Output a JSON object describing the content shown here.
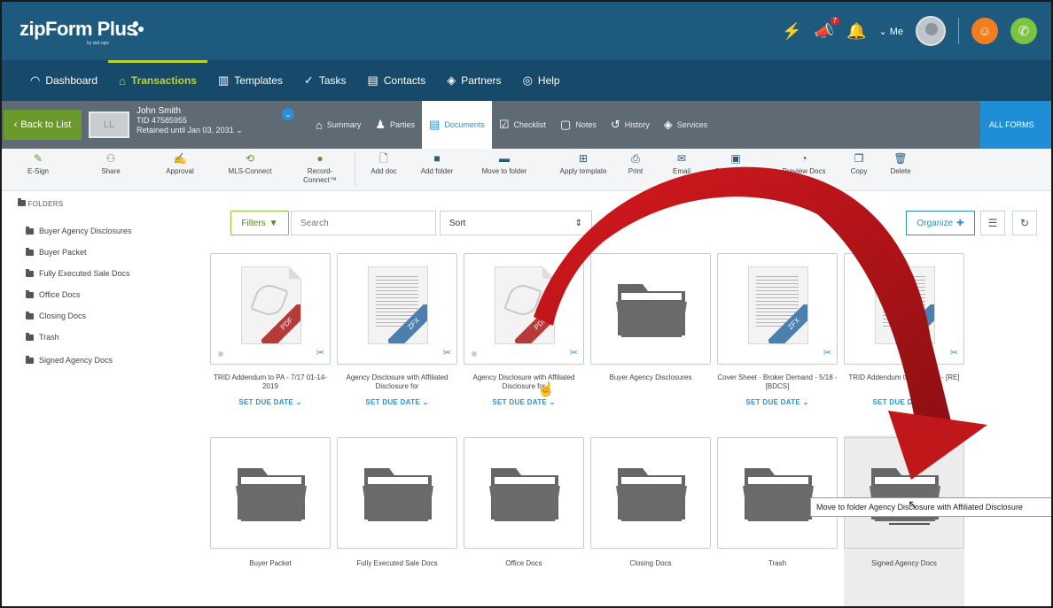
{
  "header": {
    "logo": "zipForm Plus",
    "logo_sub": "by zipLogix",
    "notification_badge": "7",
    "me_label": "Me"
  },
  "nav": [
    {
      "label": "Dashboard",
      "icon": "dashboard-icon"
    },
    {
      "label": "Transactions",
      "icon": "home-icon"
    },
    {
      "label": "Templates",
      "icon": "templates-icon"
    },
    {
      "label": "Tasks",
      "icon": "tasks-icon"
    },
    {
      "label": "Contacts",
      "icon": "contacts-icon"
    },
    {
      "label": "Partners",
      "icon": "partners-icon"
    },
    {
      "label": "Help",
      "icon": "help-icon"
    }
  ],
  "transaction": {
    "back_label": "Back to List",
    "thumb_label": "LL",
    "name": "John Smith",
    "tid": "TID 47585955",
    "retained": "Retained until Jan 03, 2031",
    "tabs": [
      "Summary",
      "Parties",
      "Documents",
      "Checklist",
      "Notes",
      "History",
      "Services"
    ],
    "all_forms": "ALL FORMS"
  },
  "toolbar": [
    {
      "label": "E-Sign"
    },
    {
      "label": "Share"
    },
    {
      "label": "Approval"
    },
    {
      "label": "MLS-Connect"
    },
    {
      "label": "Record-Connect™"
    },
    {
      "label": "Add doc"
    },
    {
      "label": "Add folder"
    },
    {
      "label": "Move to folder"
    },
    {
      "label": "Apply template"
    },
    {
      "label": "Print"
    },
    {
      "label": "Email"
    },
    {
      "label": "Save as PDF"
    },
    {
      "label": "Preview Docs"
    },
    {
      "label": "Copy"
    },
    {
      "label": "Delete"
    }
  ],
  "sidebar": {
    "title": "FOLDERS",
    "folders": [
      "Buyer Agency Disclosures",
      "Buyer Packet",
      "Fully Executed Sale Docs",
      "Office Docs",
      "Closing Docs",
      "Trash",
      "Signed Agency Docs"
    ]
  },
  "controls": {
    "filters": "Filters",
    "search_placeholder": "Search",
    "sort": "Sort",
    "organize": "Organize"
  },
  "row1": [
    {
      "type": "pdf",
      "label": "TRID Addendum to PA - 7/17 01-14-2019",
      "band": "PDF",
      "due": "SET DUE DATE"
    },
    {
      "type": "zfx",
      "label": "Agency Disclosure with Affiliated Disclosure for",
      "band": "ZFX",
      "due": "SET DUE DATE"
    },
    {
      "type": "pdf",
      "label": "Agency Disclosure with Affiliated Disclosure for",
      "band": "PDF",
      "due": "SET DUE DATE"
    },
    {
      "type": "folder",
      "label": "Buyer Agency Disclosures"
    },
    {
      "type": "zfx",
      "label": "Cover Sheet - Broker Demand - 5/18 - [BDCS]",
      "band": "ZFX",
      "due": "SET DUE DATE"
    },
    {
      "type": "zfx",
      "label": "TRID Addendum to PA - 7/17 - [RE]",
      "band": "ZFX",
      "due": "SET DUE DATE"
    }
  ],
  "row2": [
    "Buyer Packet",
    "Fully Executed Sale Docs",
    "Office Docs",
    "Closing Docs",
    "Trash",
    "Signed Agency Docs"
  ],
  "tooltip": "Move to folder Agency Disclosure with Affiliated Disclosure",
  "colors": {
    "header": "#1d5a7e",
    "nav": "#17496a",
    "accent_green": "#b8d430",
    "arrow": "#c0171b",
    "link_blue": "#2b8fd6"
  }
}
